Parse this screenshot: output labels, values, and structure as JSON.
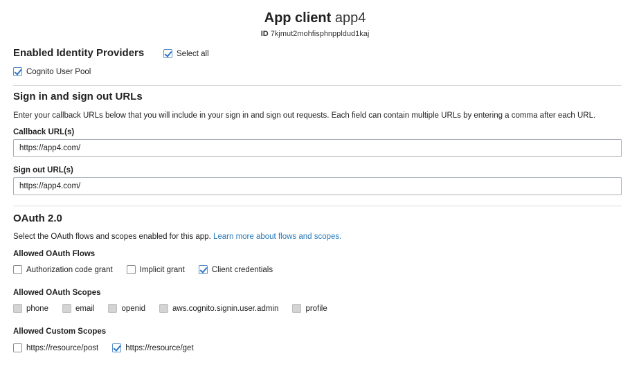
{
  "header": {
    "title_bold": "App client",
    "client_name": "app4",
    "id_label": "ID",
    "id_value": "7kjmut2mohfisphnppldud1kaj"
  },
  "identity_providers": {
    "heading": "Enabled Identity Providers",
    "select_all_label": "Select all",
    "select_all_checked": true,
    "providers": [
      {
        "label": "Cognito User Pool",
        "checked": true
      }
    ]
  },
  "urls": {
    "heading": "Sign in and sign out URLs",
    "description": "Enter your callback URLs below that you will include in your sign in and sign out requests. Each field can contain multiple URLs by entering a comma after each URL.",
    "callback_label": "Callback URL(s)",
    "callback_value": "https://app4.com/",
    "signout_label": "Sign out URL(s)",
    "signout_value": "https://app4.com/"
  },
  "oauth": {
    "heading": "OAuth 2.0",
    "description": "Select the OAuth flows and scopes enabled for this app.",
    "learn_more": "Learn more about flows and scopes.",
    "flows_label": "Allowed OAuth Flows",
    "flows": [
      {
        "label": "Authorization code grant",
        "checked": false
      },
      {
        "label": "Implicit grant",
        "checked": false
      },
      {
        "label": "Client credentials",
        "checked": true
      }
    ],
    "scopes_label": "Allowed OAuth Scopes",
    "scopes": [
      {
        "label": "phone",
        "checked": false,
        "disabled": true
      },
      {
        "label": "email",
        "checked": false,
        "disabled": true
      },
      {
        "label": "openid",
        "checked": false,
        "disabled": true
      },
      {
        "label": "aws.cognito.signin.user.admin",
        "checked": false,
        "disabled": true
      },
      {
        "label": "profile",
        "checked": false,
        "disabled": true
      }
    ],
    "custom_scopes_label": "Allowed Custom Scopes",
    "custom_scopes": [
      {
        "label": "https://resource/post",
        "checked": false
      },
      {
        "label": "https://resource/get",
        "checked": true
      }
    ]
  },
  "colors": {
    "link": "#2a7ab8",
    "check": "#2a74c6",
    "disabled_box": "#d4d4d4"
  }
}
